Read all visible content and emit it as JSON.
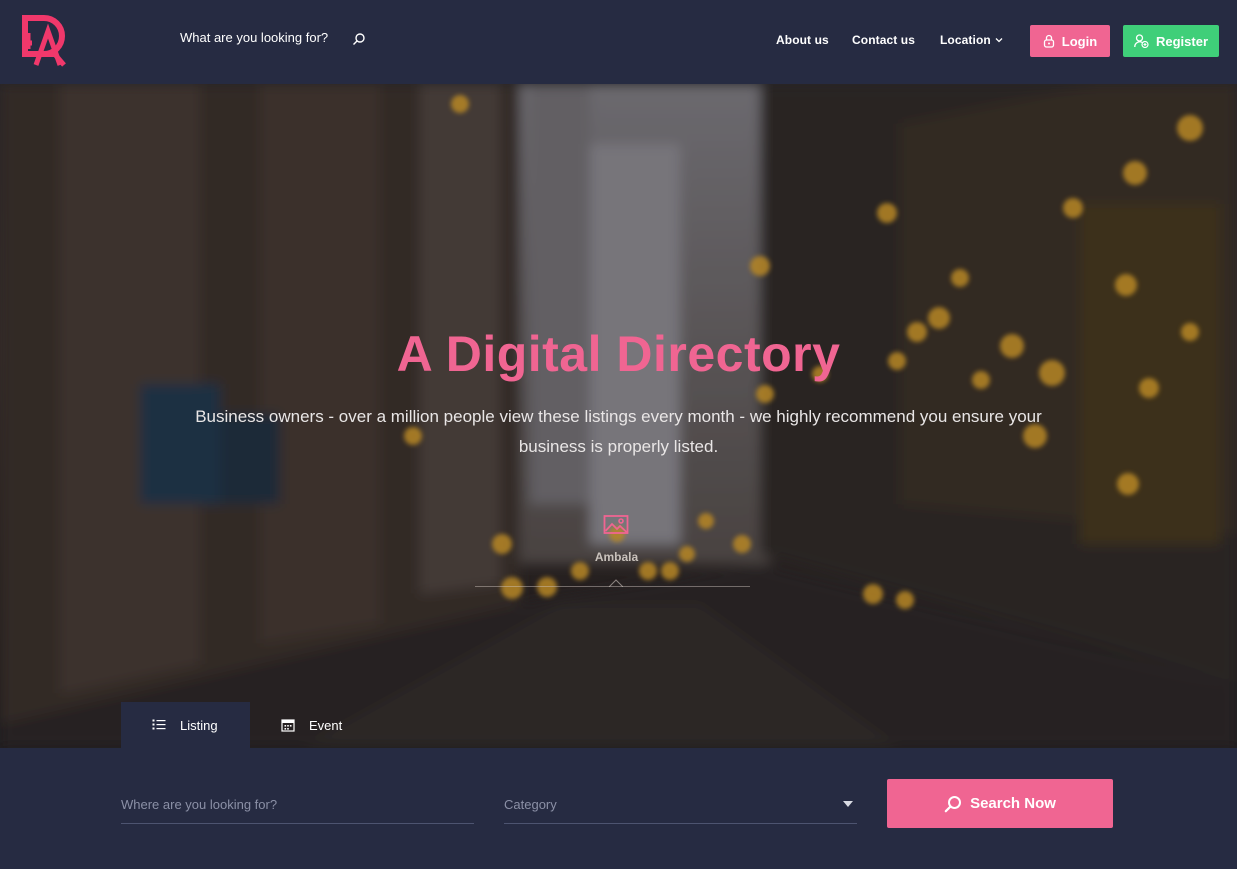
{
  "header": {
    "search_label": "What are you looking for?",
    "nav": {
      "about": "About us",
      "contact": "Contact us",
      "location": "Location"
    },
    "login_label": "Login",
    "register_label": "Register"
  },
  "hero": {
    "title": "A Digital Directory",
    "subtitle": "Business owners - over a million people view these listings every month - we highly recommend you ensure your business is properly listed.",
    "location_name": "Ambala"
  },
  "tabs": [
    {
      "label": "Listing",
      "icon": "list-icon",
      "active": true
    },
    {
      "label": "Event",
      "icon": "calendar-icon",
      "active": false
    }
  ],
  "search": {
    "where_placeholder": "Where are you looking for?",
    "category_placeholder": "Category",
    "button_label": "Search Now"
  },
  "colors": {
    "brand_pink": "#f06592",
    "register_green": "#3fcf79",
    "dark_navy": "#262b42"
  }
}
